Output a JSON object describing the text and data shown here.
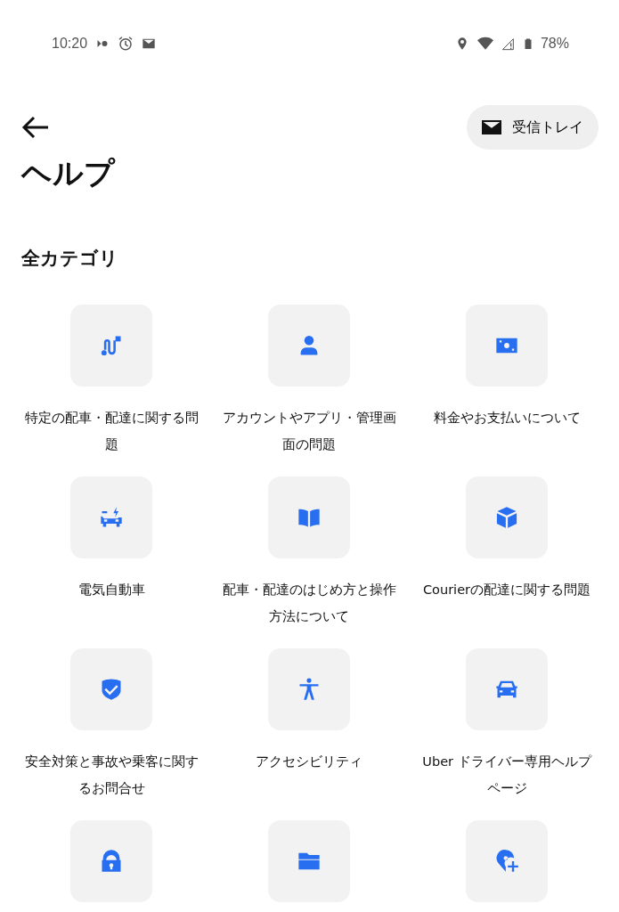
{
  "status_bar": {
    "time": "10:20",
    "battery": "78%"
  },
  "header": {
    "inbox_button": "受信トレイ",
    "title": "ヘルプ"
  },
  "section_title": "全カテゴリ",
  "categories": [
    {
      "kind": "labeled",
      "label": "特定の配車・配達に関する問題"
    },
    {
      "kind": "labeled",
      "label": "アカウントやアプリ・管理画面の問題"
    },
    {
      "kind": "labeled",
      "label": "料金やお支払いについて"
    },
    {
      "kind": "labeled",
      "label": "電気自動車"
    },
    {
      "kind": "labeled",
      "label": "配車・配達のはじめ方と操作方法について"
    },
    {
      "kind": "labeled",
      "label": "Courierの配達に関する問題"
    },
    {
      "kind": "labeled",
      "label": "安全対策と事故や乗客に関するお問合せ"
    },
    {
      "kind": "labeled",
      "label": "アクセシビリティ"
    },
    {
      "kind": "labeled",
      "label": "Uber ドライバー専用ヘルプページ"
    },
    {
      "kind": "cut_off"
    },
    {
      "kind": "cut_off"
    },
    {
      "kind": "cut_off"
    }
  ]
}
